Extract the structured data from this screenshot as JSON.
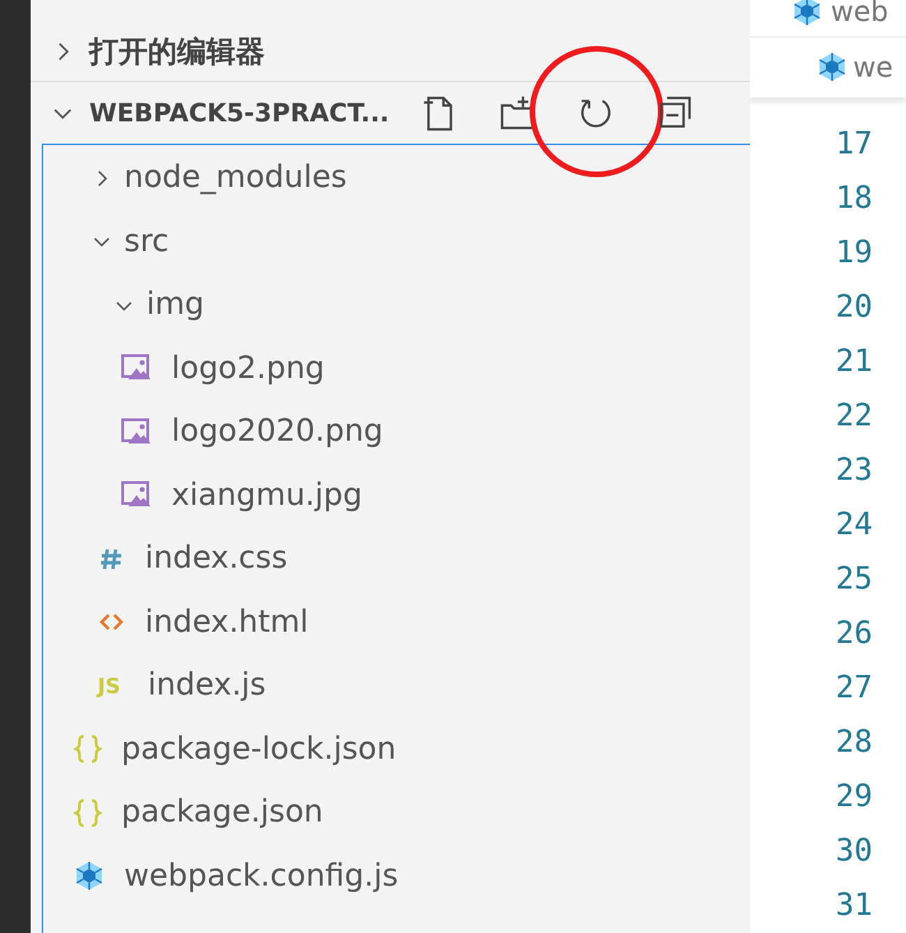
{
  "open_editors": {
    "label": "打开的编辑器",
    "expanded": false
  },
  "project": {
    "label": "WEBPACK5-3PRACT...",
    "expanded": true,
    "actions": [
      {
        "kind": "new-file",
        "circled": false
      },
      {
        "kind": "new-folder",
        "circled": false
      },
      {
        "kind": "refresh",
        "circled": true
      },
      {
        "kind": "collapse",
        "circled": false
      }
    ],
    "tree": [
      {
        "name": "node_modules",
        "kind": "folder",
        "expanded": false
      },
      {
        "name": "src",
        "kind": "folder",
        "expanded": true,
        "children": [
          {
            "name": "img",
            "kind": "folder",
            "expanded": true,
            "children": [
              {
                "name": "logo2.png",
                "kind": "image"
              },
              {
                "name": "logo2020.png",
                "kind": "image"
              },
              {
                "name": "xiangmu.jpg",
                "kind": "image"
              }
            ]
          },
          {
            "name": "index.css",
            "kind": "css"
          },
          {
            "name": "index.html",
            "kind": "html"
          },
          {
            "name": "index.js",
            "kind": "js",
            "badge": "JS"
          }
        ]
      },
      {
        "name": "package-lock.json",
        "kind": "json"
      },
      {
        "name": "package.json",
        "kind": "json"
      },
      {
        "name": "webpack.config.js",
        "kind": "webpack"
      }
    ]
  },
  "editor": {
    "tabs": [
      {
        "label": "web",
        "kind": "webpack"
      },
      {
        "label": "we",
        "kind": "webpack"
      }
    ],
    "line_numbers": [
      "17",
      "18",
      "19",
      "20",
      "21",
      "22",
      "23",
      "24",
      "25",
      "26",
      "27",
      "28",
      "29",
      "30",
      "31"
    ]
  }
}
